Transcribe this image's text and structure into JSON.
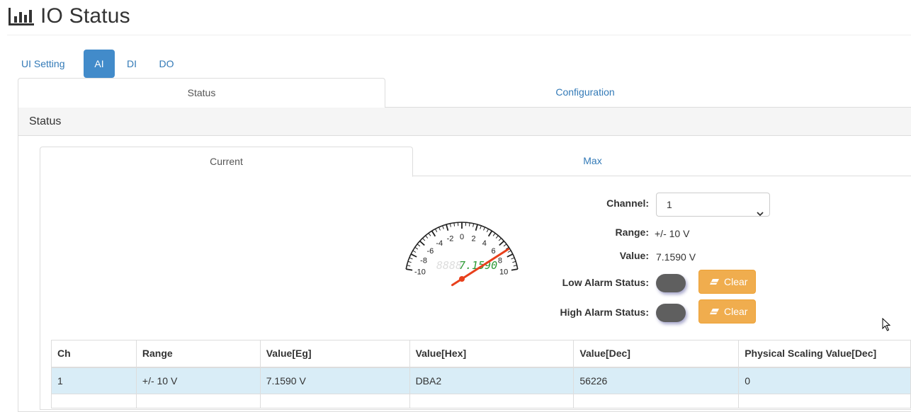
{
  "header": {
    "title": "IO Status",
    "icon": "bar-chart-icon"
  },
  "main_tabs": [
    {
      "label": "UI Setting",
      "active": false
    },
    {
      "label": "AI",
      "active": true
    },
    {
      "label": "DI",
      "active": false
    },
    {
      "label": "DO",
      "active": false
    }
  ],
  "sub_tabs": [
    {
      "label": "Status",
      "active": true
    },
    {
      "label": "Configuration",
      "active": false
    }
  ],
  "panel": {
    "heading": "Status"
  },
  "inner_tabs": [
    {
      "label": "Current",
      "active": true
    },
    {
      "label": "Max",
      "active": false
    }
  ],
  "gauge": {
    "min": -10,
    "max": 10,
    "value": 7.159,
    "tick_labels": [
      "-10",
      "-8",
      "-6",
      "-4",
      "-2",
      "0",
      "2",
      "4",
      "6",
      "8",
      "10"
    ],
    "display_text": "7.1590",
    "display_ghost": "8888",
    "needle_color": "#e8401c",
    "display_color": "#2e9b36"
  },
  "form": {
    "channel_label": "Channel:",
    "channel_value": "1",
    "range_label": "Range:",
    "range_value": "+/- 10 V",
    "value_label": "Value:",
    "value_value": "7.1590 V",
    "low_alarm_label": "Low Alarm Status:",
    "high_alarm_label": "High Alarm Status:",
    "clear_label": "Clear"
  },
  "table": {
    "headers": [
      "Ch",
      "Range",
      "Value[Eg]",
      "Value[Hex]",
      "Value[Dec]",
      "Physical Scaling Value[Dec]"
    ],
    "rows": [
      [
        "1",
        "+/- 10 V",
        "7.1590 V",
        "DBA2",
        "56226",
        "0"
      ]
    ]
  },
  "colors": {
    "accent": "#428bca",
    "link": "#337ab7",
    "warning": "#f0ad4e",
    "selected_row": "#d9edf7",
    "toggle_off": "#5f5f5f"
  }
}
